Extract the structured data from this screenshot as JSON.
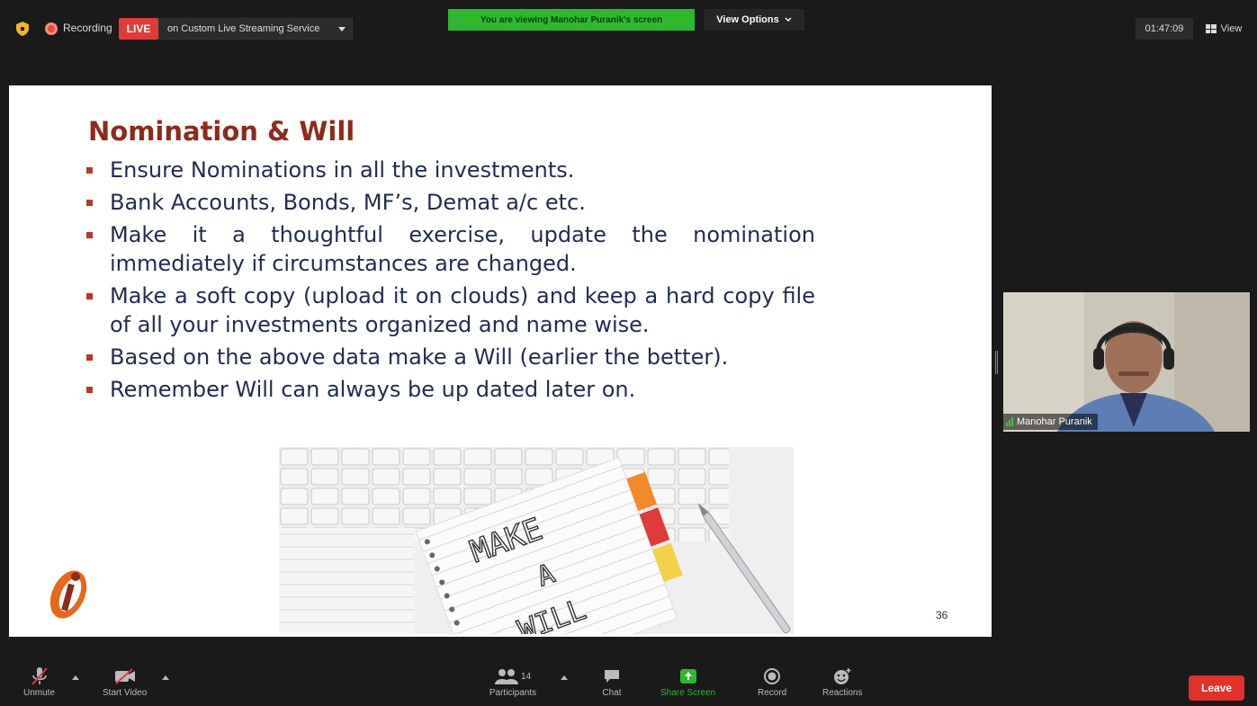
{
  "topbar": {
    "recording_label": "Recording",
    "live_label": "LIVE",
    "stream_service": "on Custom Live Streaming Service",
    "viewing_banner": "You are viewing Manohar Puranik's screen",
    "view_options_label": "View Options",
    "timer": "01:47:09",
    "view_label": "View"
  },
  "slide": {
    "title": "Nomination & Will",
    "bullets": [
      "Ensure Nominations in all the investments.",
      "Bank Accounts, Bonds, MF’s, Demat a/c etc.",
      "Make it a thoughtful exercise, update the nomination immediately if circumstances are changed.",
      "Make a soft copy (upload it on clouds) and keep a hard copy file of all your investments organized and name wise.",
      "Based on the above data make a Will (earlier the better).",
      "Remember Will can always be up dated later on."
    ],
    "image_text": [
      "MAKE",
      "A",
      "WILL"
    ],
    "page_number": "36",
    "colors": {
      "title": "#8e2a1c",
      "body": "#1f2d4d",
      "bullet": "#b33a2b",
      "logo": "#e8651a"
    }
  },
  "participant": {
    "name": "Manohar Puranik"
  },
  "toolbar": {
    "unmute_label": "Unmute",
    "start_video_label": "Start Video",
    "participants_label": "Participants",
    "participants_count": "14",
    "chat_label": "Chat",
    "share_screen_label": "Share Screen",
    "record_label": "Record",
    "reactions_label": "Reactions",
    "leave_label": "Leave",
    "colors": {
      "share": "#2fb82f",
      "leave": "#e0322b"
    }
  }
}
